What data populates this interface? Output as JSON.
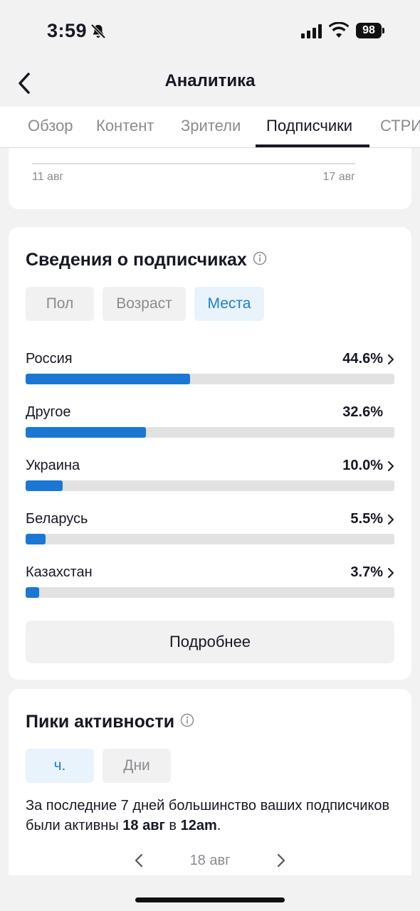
{
  "status_bar": {
    "time": "3:59",
    "battery": "98",
    "icons": [
      "bell-slash-icon",
      "signal-icon",
      "wifi-icon",
      "battery-icon"
    ]
  },
  "header": {
    "title": "Аналитика",
    "back_icon": "chevron-left-icon"
  },
  "tabs": [
    {
      "label": "Обзор",
      "active": false
    },
    {
      "label": "Контент",
      "active": false
    },
    {
      "label": "Зрители",
      "active": false
    },
    {
      "label": "Подписчики",
      "active": true
    },
    {
      "label": "СТРИ",
      "active": false
    }
  ],
  "chart_dates": {
    "start": "11 авг",
    "end": "17 авг"
  },
  "followers": {
    "title": "Сведения о подписчиках",
    "segments": [
      {
        "label": "Пол",
        "selected": false
      },
      {
        "label": "Возраст",
        "selected": false
      },
      {
        "label": "Места",
        "selected": true
      }
    ],
    "locations": [
      {
        "name": "Россия",
        "percent_label": "44.6%",
        "value": 44.6,
        "has_chevron": true
      },
      {
        "name": "Другое",
        "percent_label": "32.6%",
        "value": 32.6,
        "has_chevron": false
      },
      {
        "name": "Украина",
        "percent_label": "10.0%",
        "value": 10.0,
        "has_chevron": true
      },
      {
        "name": "Беларусь",
        "percent_label": "5.5%",
        "value": 5.5,
        "has_chevron": true
      },
      {
        "name": "Казахстан",
        "percent_label": "3.7%",
        "value": 3.7,
        "has_chevron": true
      }
    ],
    "more_label": "Подробнее"
  },
  "activity": {
    "title": "Пики активности",
    "segments": [
      {
        "label": "ч.",
        "selected": true
      },
      {
        "label": "Дни",
        "selected": false
      }
    ],
    "text_prefix": "За последние 7 дней большинство ваших подписчиков были активны ",
    "text_date": "18 авг",
    "text_mid": " в ",
    "text_time": "12am",
    "text_suffix": ".",
    "nav_date": "18 авг"
  },
  "colors": {
    "accent": "#1a77d4",
    "selected_bg": "#e8f3fc",
    "track": "#e2e2e3",
    "page_bg": "#f2f2f3"
  }
}
